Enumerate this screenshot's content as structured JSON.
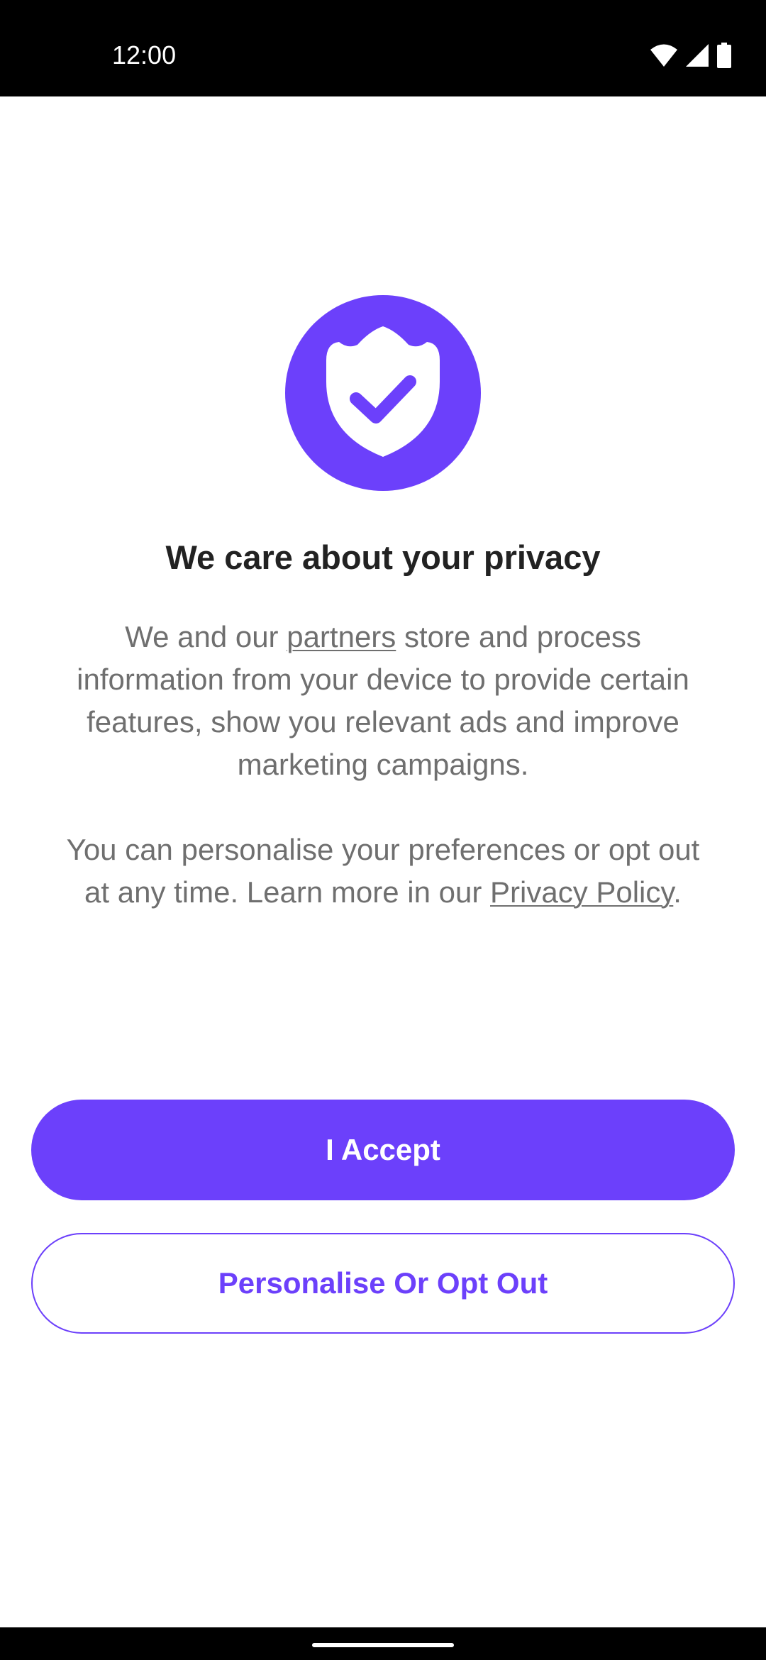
{
  "status_bar": {
    "time": "12:00",
    "icons": [
      "wifi-icon",
      "cellular-signal-icon",
      "battery-icon"
    ]
  },
  "consent": {
    "icon": "shield-check-icon",
    "title": "We care about your privacy",
    "paragraph1": {
      "before_link": "We and our ",
      "link": "partners",
      "after_link": " store and process information from your device to provide certain features, show you relevant ads and improve marketing campaigns."
    },
    "paragraph2": {
      "before_link": "You can personalise your preferences or opt out at any time. Learn more in our ",
      "link": "Privacy Policy",
      "after_link": "."
    },
    "accept_label": "I Accept",
    "personalise_label": "Personalise Or Opt Out"
  },
  "colors": {
    "accent": "#6c40fb",
    "title_text": "#222222",
    "body_text": "#6f6f6f",
    "status_bar": "#000000"
  }
}
